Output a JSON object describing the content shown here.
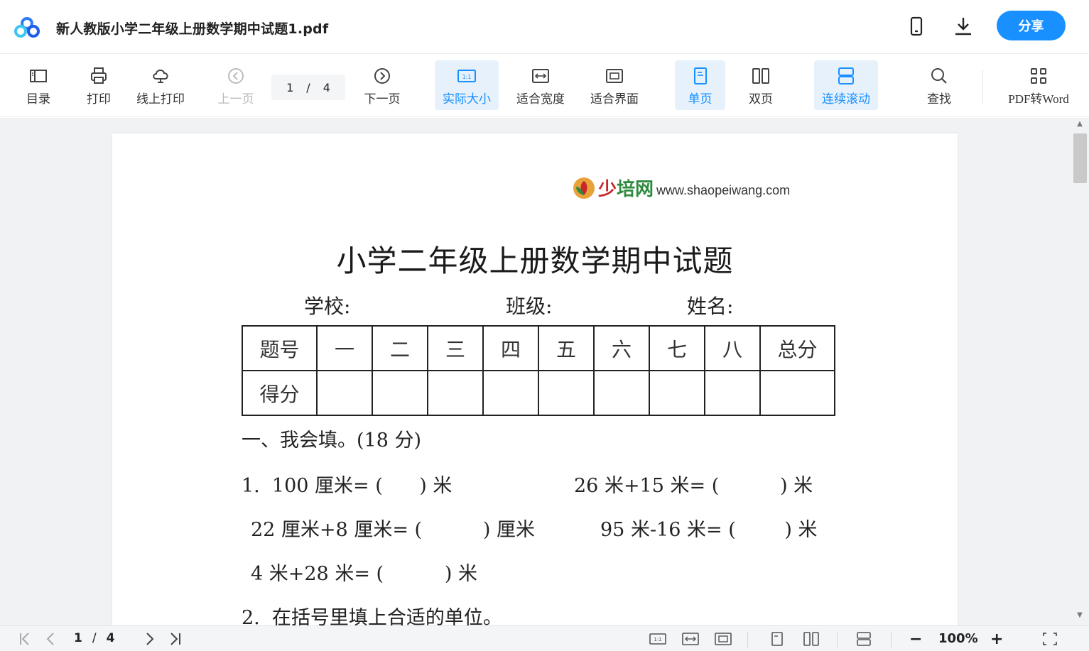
{
  "titlebar": {
    "doc_title": "新人教版小学二年级上册数学期中试题1.pdf",
    "share_label": "分享",
    "icons": [
      "app-logo-icon",
      "mobile-icon",
      "download-icon"
    ]
  },
  "toolbar": {
    "toc": "目录",
    "print": "打印",
    "online_print": "线上打印",
    "prev_page": "上一页",
    "page_current": "1",
    "page_sep": "/",
    "page_total": "4",
    "next_page": "下一页",
    "actual_size": "实际大小",
    "fit_width": "适合宽度",
    "fit_page": "适合界面",
    "single_page": "单页",
    "double_page": "双页",
    "continuous_scroll": "连续滚动",
    "search": "查找",
    "pdf_to_word": "PDF转Word",
    "actual_size_icon_text": "1:1",
    "accent_color": "#1890ff"
  },
  "document": {
    "brand_cn_1": "少",
    "brand_cn_2": "培网",
    "brand_url": "www.shaopeiwang.com",
    "title": "小学二年级上册数学期中试题",
    "school_label": "学校:",
    "class_label": "班级:",
    "name_label": "姓名:",
    "table_header": [
      "题号",
      "一",
      "二",
      "三",
      "四",
      "五",
      "六",
      "七",
      "八",
      "总分"
    ],
    "table_row_label": "得分",
    "section1": "一、我会填。(18 分)",
    "q1_a": "1.  100 厘米= (      ) 米",
    "q1_b": "26 米+15 米= (          ) 米",
    "q1_c": "22 厘米+8 厘米= (          ) 厘米",
    "q1_d": "95 米-16 米= (        ) 米",
    "q1_e": "4 米+28 米= (          ) 米",
    "q2": "2.  在括号里填上合适的单位。"
  },
  "bottombar": {
    "page_current": "1",
    "page_sep": "/",
    "page_total": "4",
    "zoom": "100%",
    "zoom_out": "−",
    "zoom_in": "+",
    "actual_size_icon_text": "1:1"
  }
}
